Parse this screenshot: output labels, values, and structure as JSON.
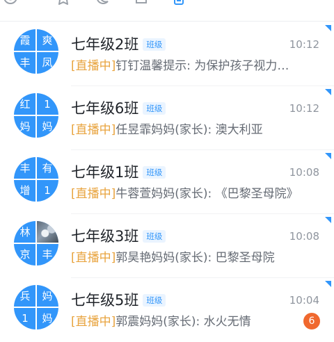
{
  "colors": {
    "accent": "#3296fa",
    "live": "#e8a33d",
    "badge": "#f0682e"
  },
  "topbar": {
    "icons": [
      "at-icon",
      "star-icon",
      "moon-icon",
      "document-icon",
      "phone-icon",
      "more-icon"
    ]
  },
  "chats": [
    {
      "avatar": [
        "霞",
        "爽",
        "丰",
        "凤"
      ],
      "title": "七年级2班",
      "tag": "班级",
      "time": "10:12",
      "live": "[直播中]",
      "message": "钉钉温馨提示: 为保护孩子视力…",
      "badge": ""
    },
    {
      "avatar": [
        "红",
        "1",
        "妈",
        "妈"
      ],
      "title": "七年级6班",
      "tag": "班级",
      "time": "10:12",
      "live": "[直播中]",
      "message": "任昱霏妈妈(家长): 澳大利亚",
      "badge": ""
    },
    {
      "avatar": [
        "丰",
        "有",
        "增",
        "1"
      ],
      "title": "七年级1班",
      "tag": "班级",
      "time": "10:08",
      "live": "[直播中]",
      "message": "牛蓉萱妈妈(家长): 《巴黎圣母院》",
      "badge": ""
    },
    {
      "avatar": [
        "林",
        "",
        "京",
        "丰"
      ],
      "title": "七年级3班",
      "tag": "班级",
      "time": "10:08",
      "live": "[直播中]",
      "message": "郭昊艳妈妈(家长): 巴黎圣母院",
      "badge": ""
    },
    {
      "avatar": [
        "兵",
        "妈",
        "1",
        "妈"
      ],
      "title": "七年级5班",
      "tag": "班级",
      "time": "10:04",
      "live": "[直播中]",
      "message": "郭震妈妈(家长): 水火无情",
      "badge": "6"
    }
  ]
}
